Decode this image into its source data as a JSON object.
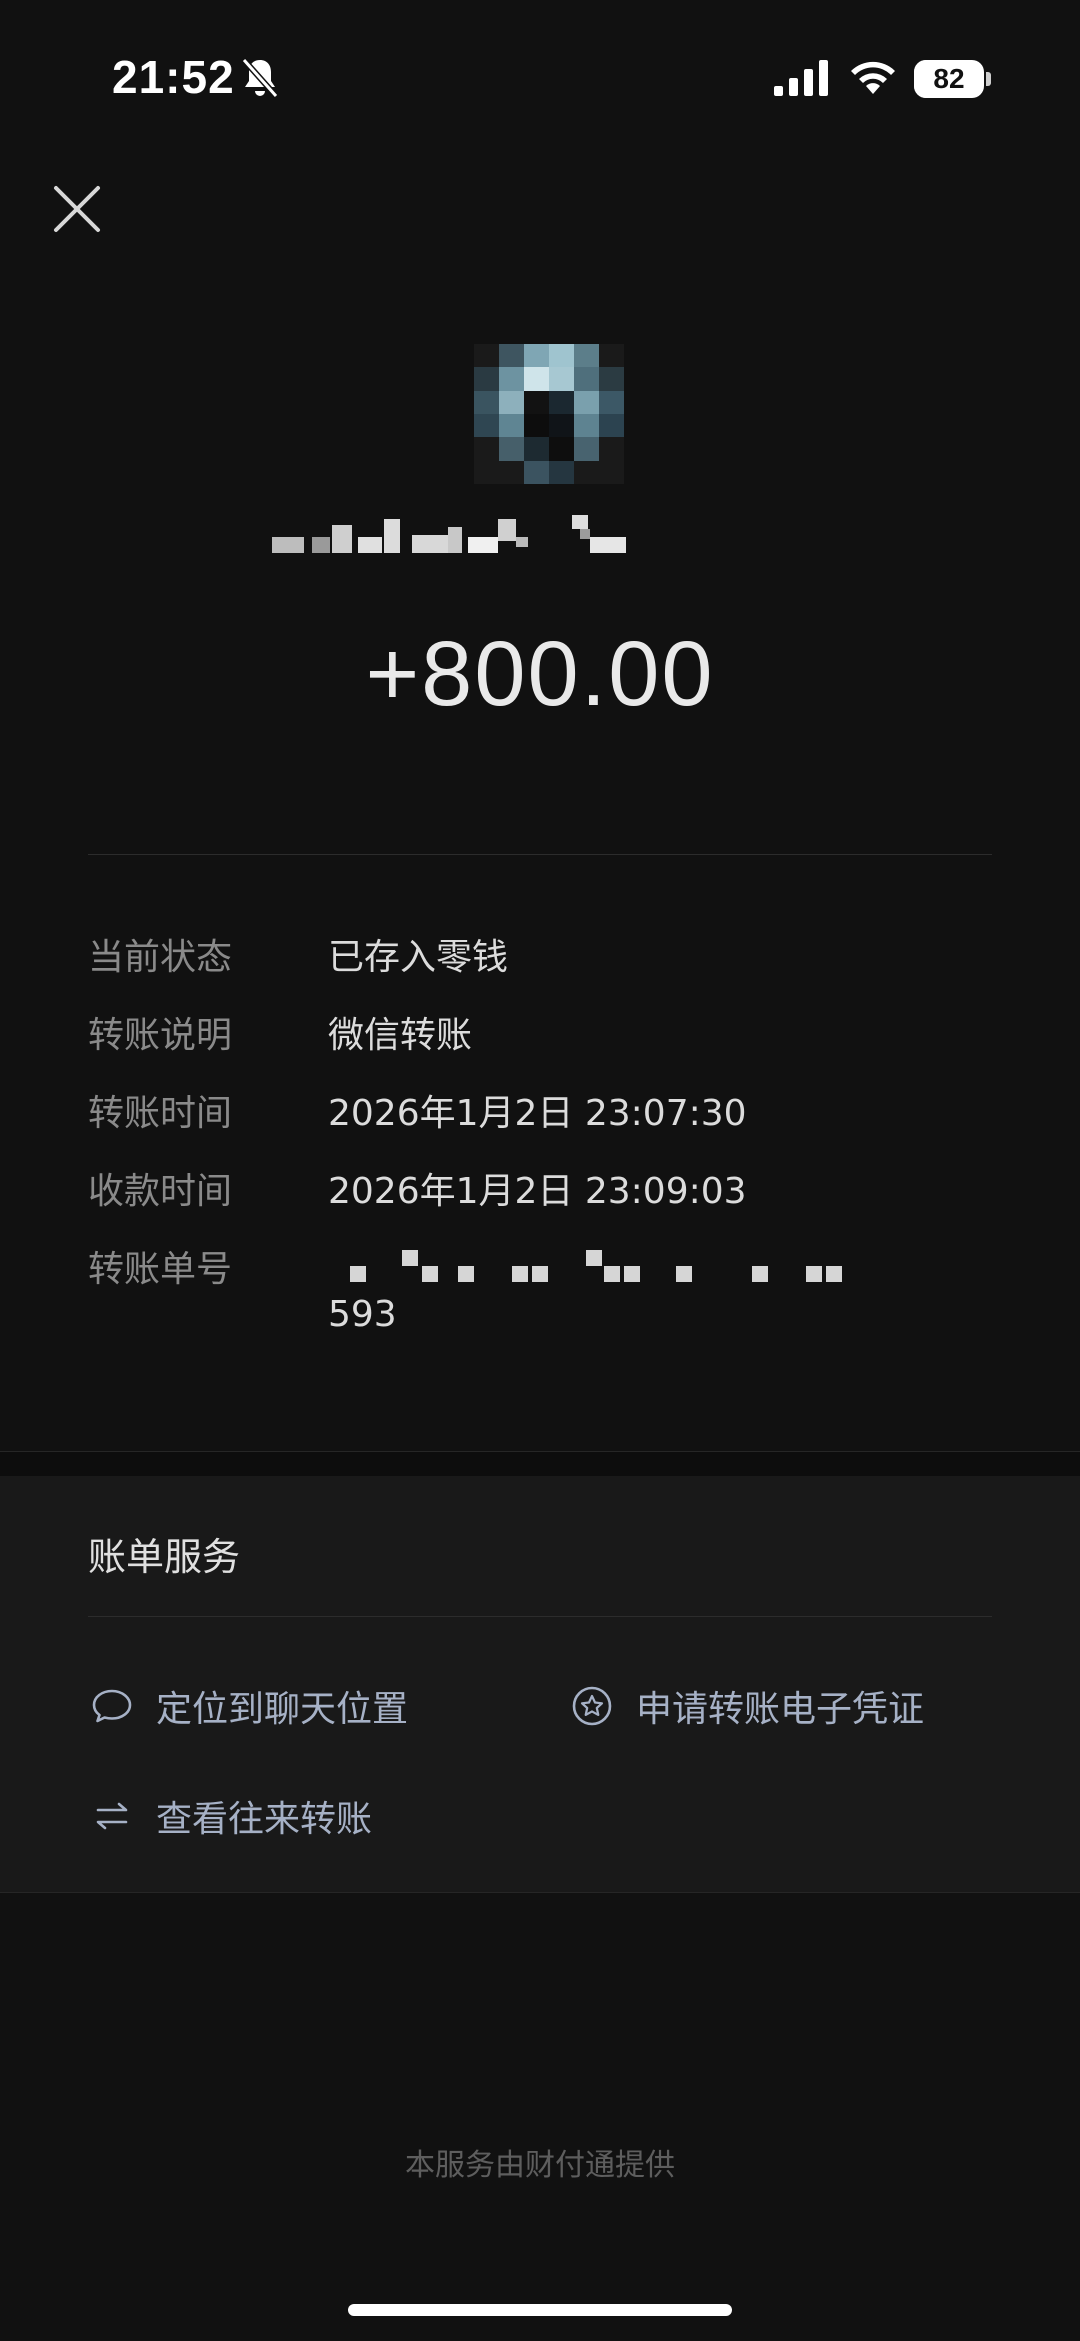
{
  "status_bar": {
    "time": "21:52",
    "battery": "82",
    "battery_level_fraction": 0.82,
    "icons": [
      "bell-off-icon",
      "cellular-signal-icon",
      "wifi-icon",
      "battery-icon"
    ]
  },
  "header": {
    "close_icon": "close-icon"
  },
  "transfer": {
    "amount": "+800.00"
  },
  "details": [
    {
      "label": "当前状态",
      "value": "已存入零钱"
    },
    {
      "label": "转账说明",
      "value": "微信转账"
    },
    {
      "label": "转账时间",
      "value": "2026年1月2日 23:07:30"
    },
    {
      "label": "收款时间",
      "value": "2026年1月2日 23:09:03"
    },
    {
      "label": "转账单号",
      "value": "593"
    }
  ],
  "services": {
    "title": "账单服务",
    "items": [
      {
        "label": "定位到聊天位置",
        "icon": "chat-bubble-icon"
      },
      {
        "label": "申请转账电子凭证",
        "icon": "star-badge-icon"
      },
      {
        "label": "查看往来转账",
        "icon": "exchange-arrows-icon"
      }
    ]
  },
  "footer": {
    "text": "本服务由财付通提供"
  },
  "colors": {
    "background": "#111111",
    "panel": "#191919",
    "link": "#a6b1c6",
    "label": "#8a8a8a"
  }
}
